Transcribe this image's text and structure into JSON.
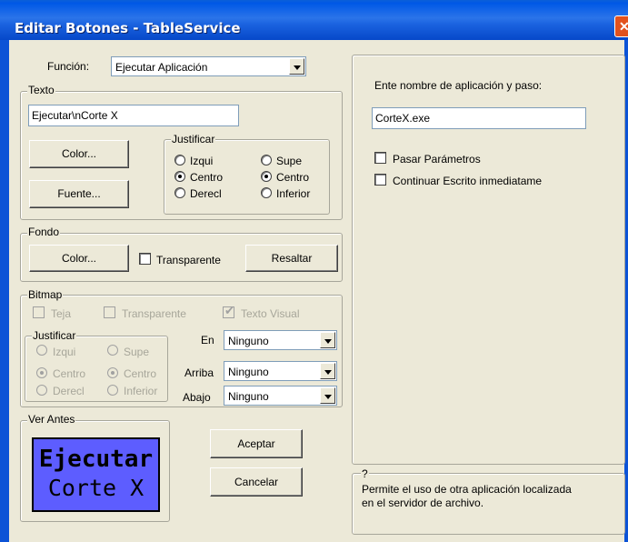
{
  "window": {
    "title": "Editar Botones - TableService",
    "close_glyph": "✕"
  },
  "funcion": {
    "label": "Función:",
    "value": "Ejecutar Aplicación"
  },
  "texto": {
    "group_label": "Texto",
    "value": "Ejecutar\\nCorte X",
    "color_button": "Color...",
    "font_button": "Fuente...",
    "justificar": {
      "group_label": "Justificar",
      "horizontal": [
        "Izqui",
        "Centro",
        "Derecl"
      ],
      "vertical": [
        "Supe",
        "Centro",
        "Inferior"
      ],
      "selected_horizontal": "Centro",
      "selected_vertical": "Centro"
    }
  },
  "fondo": {
    "group_label": "Fondo",
    "color_button": "Color...",
    "transparente_label": "Transparente",
    "resaltar_button": "Resaltar"
  },
  "bitmap": {
    "group_label": "Bitmap",
    "teja_label": "Teja",
    "transparente_label": "Transparente",
    "texto_visual_label": "Texto Visual",
    "justificar": {
      "group_label": "Justificar",
      "horizontal": [
        "Izqui",
        "Centro",
        "Derecl"
      ],
      "vertical": [
        "Supe",
        "Centro",
        "Inferior"
      ]
    },
    "en": {
      "label": "En",
      "value": "Ninguno"
    },
    "arriba": {
      "label": "Arriba",
      "value": "Ninguno"
    },
    "abajo": {
      "label": "Abajo",
      "value": "Ninguno"
    }
  },
  "ver_antes": {
    "group_label": "Ver Antes",
    "preview_line1": "Ejecutar",
    "preview_line2": "Corte X",
    "preview_color": "#5d5dff"
  },
  "buttons": {
    "aceptar": "Aceptar",
    "cancelar": "Cancelar"
  },
  "app_panel": {
    "prompt": "Ente nombre de aplicación y paso:",
    "app_value": "CorteX.exe",
    "pasar_parametros": "Pasar Parámetros",
    "continuar_escrito": "Continuar Escrito inmediatame"
  },
  "help": {
    "label": "?",
    "line1": "Permite el uso de otra aplicación localizada",
    "line2": "en el servidor de archivo."
  }
}
